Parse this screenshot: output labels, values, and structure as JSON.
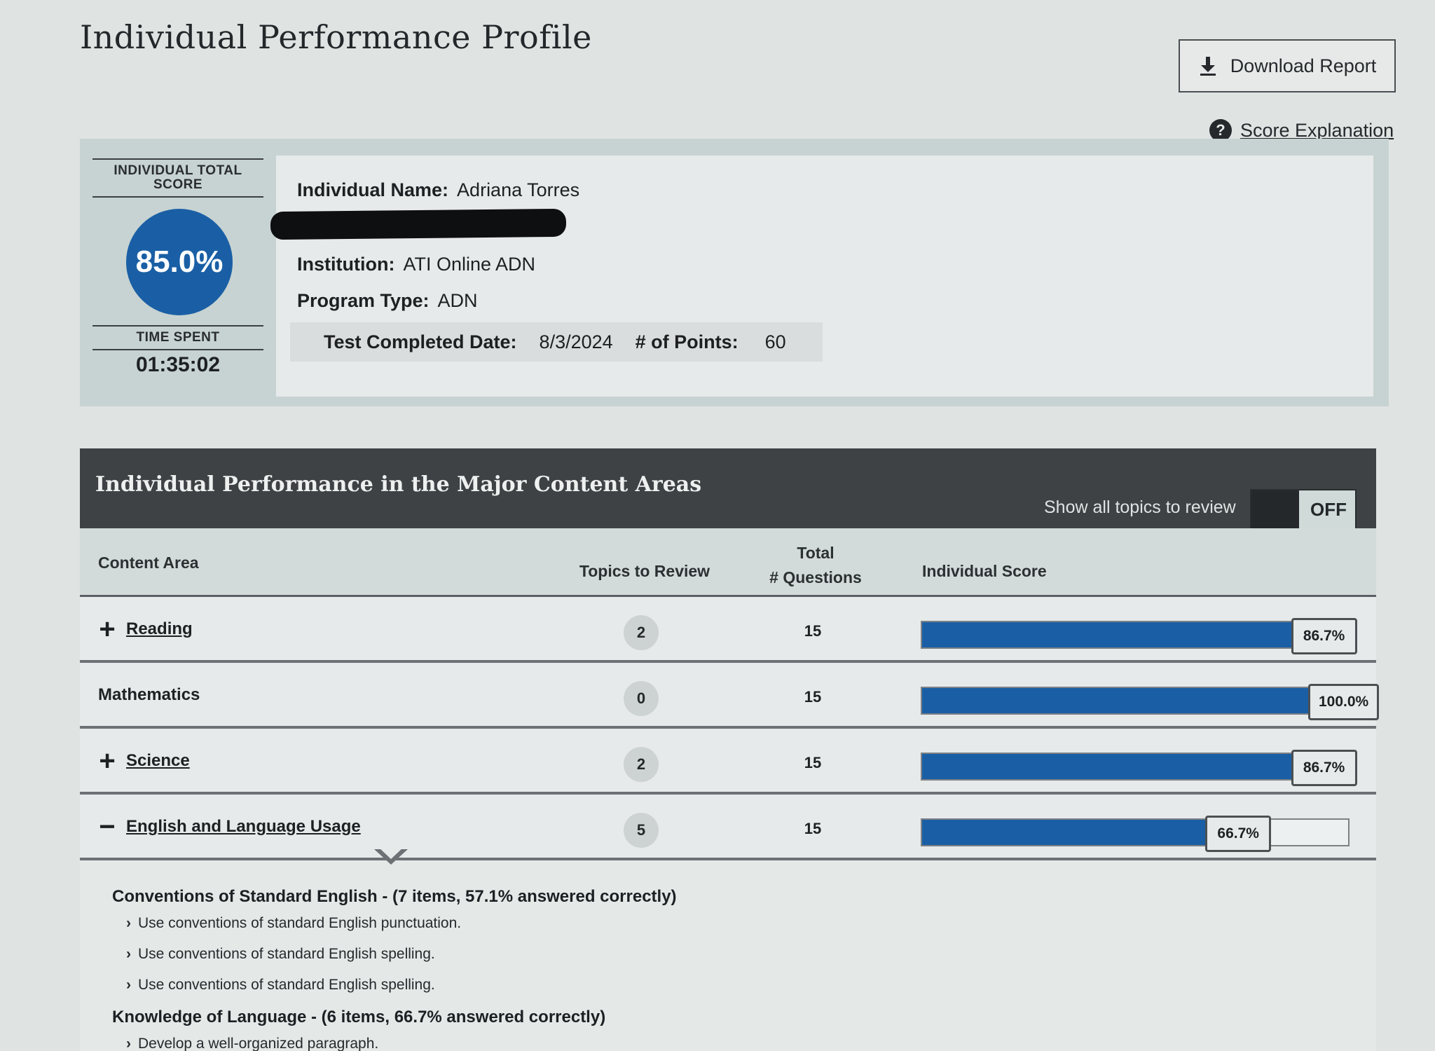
{
  "header": {
    "title": "Individual Performance Profile",
    "download_label": "Download Report",
    "score_explanation_label": "Score Explanation"
  },
  "summary": {
    "total_score_label": "INDIVIDUAL TOTAL SCORE",
    "total_score_value": "85.0%",
    "time_spent_label": "TIME SPENT",
    "time_spent_value": "01:35:02",
    "individual_name_label": "Individual Name:",
    "individual_name_value": "Adriana Torres",
    "institution_label": "Institution:",
    "institution_value": "ATI Online ADN",
    "program_type_label": "Program Type:",
    "program_type_value": "ADN",
    "test_completed_label": "Test Completed Date:",
    "test_completed_value": "8/3/2024",
    "points_label": "# of Points:",
    "points_value": "60"
  },
  "table": {
    "title": "Individual Performance in the Major Content Areas",
    "toggle_label": "Show all topics to review",
    "toggle_state": "OFF",
    "columns": {
      "content_area": "Content Area",
      "topics_to_review": "Topics to Review",
      "total_questions_line1": "Total",
      "total_questions_line2": "# Questions",
      "individual_score": "Individual Score"
    },
    "rows": [
      {
        "name": "Reading",
        "expander": "+",
        "topics_to_review": "2",
        "total_questions": "15",
        "score_label": "86.7%",
        "score": 0.867
      },
      {
        "name": "Mathematics",
        "expander": "",
        "topics_to_review": "0",
        "total_questions": "15",
        "score_label": "100.0%",
        "score": 1.0
      },
      {
        "name": "Science",
        "expander": "+",
        "topics_to_review": "2",
        "total_questions": "15",
        "score_label": "86.7%",
        "score": 0.867
      },
      {
        "name": "English and Language Usage",
        "expander": "−",
        "topics_to_review": "5",
        "total_questions": "15",
        "score_label": "66.7%",
        "score": 0.667
      }
    ],
    "expanded_details": {
      "topic1": "Conventions of Standard English - (7 items, 57.1% answered correctly)",
      "topic1_items": [
        "Use conventions of standard English punctuation.",
        "Use conventions of standard English spelling.",
        "Use conventions of standard English spelling."
      ],
      "topic2": "Knowledge of Language - (6 items, 66.7% answered correctly)",
      "topic2_items": [
        "Develop a well-organized paragraph."
      ]
    }
  },
  "colors": {
    "accent_blue": "#1a5fa5",
    "header_bar": "#3f4245"
  }
}
